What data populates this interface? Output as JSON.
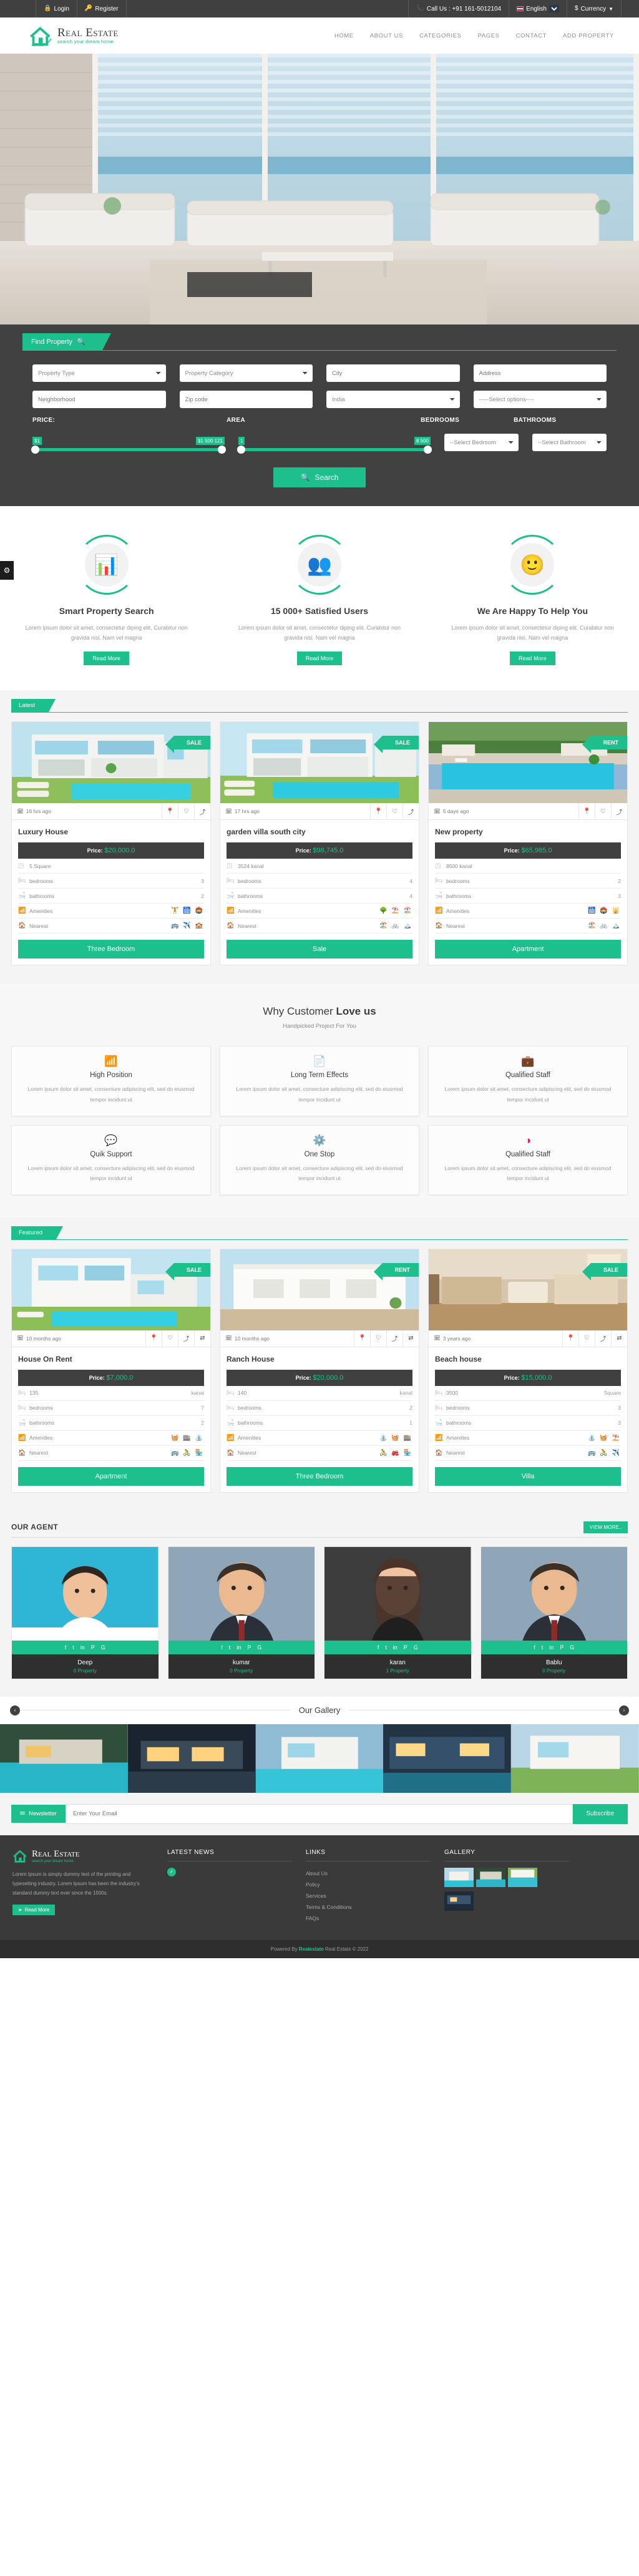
{
  "topbar": {
    "login": "Login",
    "register": "Register",
    "call_us": "Call Us : +91 161-5012104",
    "language": "English",
    "currency": "Currency",
    "lock_icon": "lock-icon",
    "key_icon": "key-icon",
    "phone_icon": "phone-icon",
    "dollar_icon": "dollar-icon"
  },
  "header": {
    "logo_title": "Real Estate",
    "logo_sub": "search your dream home",
    "nav": [
      {
        "label": "HOME"
      },
      {
        "label": "ABOUT US"
      },
      {
        "label": "CATEGORIES"
      },
      {
        "label": "PAGES"
      },
      {
        "label": "CONTACT"
      },
      {
        "label": "ADD PROPERTY"
      }
    ]
  },
  "search": {
    "tab_label": "Find Property",
    "tab_icon": "search-icon",
    "fields_row1": [
      {
        "name": "property-type",
        "type": "select",
        "value": "Property Type"
      },
      {
        "name": "property-category",
        "type": "select",
        "value": "Property Category"
      },
      {
        "name": "city",
        "type": "text",
        "placeholder": "City"
      },
      {
        "name": "address",
        "type": "text",
        "placeholder": "Address"
      }
    ],
    "fields_row2": [
      {
        "name": "neighborhood",
        "type": "text",
        "placeholder": "Neighborhood"
      },
      {
        "name": "zipcode",
        "type": "text",
        "placeholder": "Zip code"
      },
      {
        "name": "country",
        "type": "select",
        "value": "India"
      },
      {
        "name": "options",
        "type": "select",
        "value": "-----Select options----"
      }
    ],
    "labels": {
      "price": "PRICE:",
      "area": "AREA",
      "bedrooms": "BEDROOMS",
      "bathrooms": "BATHROOMS"
    },
    "price_min": "$1",
    "price_max": "$1 500 121",
    "area_min": "1",
    "area_max": "8 500",
    "bedroom_select": "--Select Bedroom",
    "bathroom_select": "--Select Bathroom",
    "search_button": "Search"
  },
  "features": [
    {
      "icon": "chart-search-icon",
      "glyph": "📊",
      "title": "Smart Property Search",
      "text": "Lorem ipsum dolor sit amet, consectetur diping elit. Curabitur non gravida nisi. Nam vel magna",
      "button": "Read More"
    },
    {
      "icon": "users-icon",
      "glyph": "👥",
      "title": "15 000+ Satisfied Users",
      "text": "Lorem ipsum dolor sit amet, consectetur diping elit. Curabitur non gravida nisi. Nam vel magna",
      "button": "Read More"
    },
    {
      "icon": "smiley-icon",
      "glyph": "🙂",
      "title": "We Are Happy To Help You",
      "text": "Lorem ipsum dolor sit amet, consectetur diping elit. Curabitur non gravida nisi. Nam vel magna",
      "button": "Read More"
    }
  ],
  "latest": {
    "ribbon": "Latest",
    "cards": [
      {
        "tag": "SALE",
        "time": "16 hrs ago",
        "title": "Luxury House",
        "price_label": "Price:",
        "price": "$20,000.0",
        "area": "5 Square",
        "bedrooms_label": "bedrooms",
        "bedrooms": "3",
        "bathrooms_label": "bathrooms",
        "bathrooms": "2",
        "amenities_label": "Amenities",
        "amenities": "🏋️ 🛗 🏟️",
        "nearest_label": "Nearest",
        "nearest": "🚌 ✈️ 🏫",
        "button": "Three Bedroom",
        "img_class": "img-villa1"
      },
      {
        "tag": "SALE",
        "time": "17 hrs ago",
        "title": "garden villa south city",
        "price_label": "Price:",
        "price": "$98,745.0",
        "area": "3524 kanal",
        "bedrooms_label": "bedrooms",
        "bedrooms": "4",
        "bathrooms_label": "bathrooms",
        "bathrooms": "4",
        "amenities_label": "Amenities",
        "amenities": "🌳 ⛱️ 🏖️",
        "nearest_label": "Nearest",
        "nearest": "🏖️ 🚲 🏔️",
        "button": "Sale",
        "img_class": "img-villa2"
      },
      {
        "tag": "RENT",
        "time": "5 days ago",
        "title": "New property",
        "price_label": "Price:",
        "price": "$65,985.0",
        "area": "8500 kanal",
        "bedrooms_label": "bedrooms",
        "bedrooms": "2",
        "bathrooms_label": "bathrooms",
        "bathrooms": "3",
        "amenities_label": "Amenities",
        "amenities": "🛗 🏟️ 🕌",
        "nearest_label": "Nearest",
        "nearest": "🏖️ 🚲 🏔️",
        "button": "Apartment",
        "img_class": "img-pool"
      }
    ]
  },
  "why": {
    "title_light": "Why Customer ",
    "title_bold": "Love us",
    "subtitle": "Handpicked Project For You",
    "cards": [
      {
        "icon": "bar-chart-icon",
        "glyph": "📶",
        "color": "#ea1e63",
        "title": "High Position",
        "text": "Lorem ipsum dolor sit amet, consecture adipiscing elit, sed do eiusmod tempor incidunt ut"
      },
      {
        "icon": "document-icon",
        "glyph": "📄",
        "color": "#14c4d4",
        "title": "Long Term Effects",
        "text": "Lorem ipsum dolor sit amet, consecture adipiscing elit, sed do eiusmod tempor incidunt ut"
      },
      {
        "icon": "briefcase-icon",
        "glyph": "💼",
        "color": "#1b8fd4",
        "title": "Qualified Staff",
        "text": "Lorem ipsum dolor sit amet, consecture adipiscing elit, sed do eiusmod tempor incidunt ut"
      },
      {
        "icon": "chat-bubble-icon",
        "glyph": "💬",
        "color": "#fbb713",
        "title": "Quik Support",
        "text": "Lorem ipsum dolor sit amet, consecture adipiscing elit, sed do eiusmod tempor incidunt ut"
      },
      {
        "icon": "gear-icon",
        "glyph": "⚙️",
        "color": "#fbb713",
        "title": "One Stop",
        "text": "Lorem ipsum dolor sit amet, consecture adipiscing elit, sed do eiusmod tempor incidunt ut"
      },
      {
        "icon": "contrast-circle-icon",
        "glyph": "◑",
        "color": "#e8195b",
        "title": "Qualified Staff",
        "text": "Lorem ipsum dolor sit amet, consecture adipiscing elit, sed do eiusmod tempor incidunt ut"
      }
    ]
  },
  "featured": {
    "ribbon": "Featured",
    "cards": [
      {
        "tag": "SALE",
        "time": "10 months ago",
        "title": "House On Rent",
        "price_label": "Price:",
        "price": "$7,000.0",
        "area_value": "135",
        "area_unit": "kanal",
        "bedrooms_label": "bedrooms",
        "bedrooms": "7",
        "bathrooms_label": "bathrooms",
        "bathrooms": "2",
        "amenities_label": "Amenities",
        "amenities": "🧺 🏬 ⛲",
        "nearest_label": "Nearest",
        "nearest": "🚌 🚴 🏪",
        "button": "Apartment",
        "img_class": "img-modern"
      },
      {
        "tag": "RENT",
        "time": "10 months ago",
        "title": "Ranch House",
        "price_label": "Price:",
        "price": "$20,000.0",
        "area_value": "140",
        "area_unit": "kanal",
        "bedrooms_label": "bedrooms",
        "bedrooms": "2",
        "bathrooms_label": "bathrooms",
        "bathrooms": "1",
        "amenities_label": "Amenities",
        "amenities": "⛲ 🧺 🏬",
        "nearest_label": "Nearest",
        "nearest": "🚴 🚒 🏪",
        "button": "Three Bedroom",
        "img_class": "img-white"
      },
      {
        "tag": "SALE",
        "time": "3 years ago",
        "title": "Beach house",
        "price_label": "Price:",
        "price": "$15,000.0",
        "area_value": "3500",
        "area_unit": "Square",
        "bedrooms_label": "bedrooms",
        "bedrooms": "3",
        "bathrooms_label": "bathrooms",
        "bathrooms": "3",
        "amenities_label": "Amenities",
        "amenities": "⛲ 🧺 ⛱️",
        "nearest_label": "Nearest",
        "nearest": "🚌 🚴 ✈️",
        "button": "Villa",
        "img_class": "img-interior"
      }
    ]
  },
  "agents": {
    "title": "OUR AGENT",
    "view_more": "VIEW MORE..",
    "socials": [
      "f",
      "t",
      "in",
      "P",
      "G"
    ],
    "list": [
      {
        "name": "Deep",
        "property": "0 Property",
        "img_class": "ag1"
      },
      {
        "name": "kumar",
        "property": "0 Property",
        "img_class": "ag2"
      },
      {
        "name": "karan",
        "property": "1 Property",
        "img_class": "ag3"
      },
      {
        "name": "Bablu",
        "property": "0 Property",
        "img_class": "ag4"
      }
    ]
  },
  "gallery": {
    "title": "Our Gallery",
    "prev_icon": "chevron-left-icon",
    "next_icon": "chevron-right-icon",
    "items": [
      {
        "img_class": "g1"
      },
      {
        "img_class": "g2"
      },
      {
        "img_class": "g3"
      },
      {
        "img_class": "g4"
      },
      {
        "img_class": "g5"
      }
    ]
  },
  "newsletter": {
    "tag": "Newsletter",
    "tag_icon": "envelope-icon",
    "placeholder": "Enter Your Email",
    "button": "Subscribe"
  },
  "footer": {
    "logo_title": "Real Estate",
    "logo_sub": "search your dream home",
    "about_text": "Lorem Ipsum is simply dummy text of the printing and typesetting industry. Lorem Ipsum has been the industry's standard dummy text ever since the 1500s.",
    "read_more": "Read More",
    "latest_news_title": "LATEST NEWS",
    "links_title": "LINKS",
    "gallery_title": "GALLERY",
    "links": [
      {
        "label": "About Us"
      },
      {
        "label": "Policy"
      },
      {
        "label": "Services"
      },
      {
        "label": "Terms & Conditions"
      },
      {
        "label": "FAQs"
      }
    ],
    "gallery_items": [
      {
        "img_class": "fg1"
      },
      {
        "img_class": "fg2"
      },
      {
        "img_class": "fg3"
      },
      {
        "img_class": "fg4"
      }
    ],
    "copyright_pre": "Powered By ",
    "copyright_brand": "Realestate",
    "copyright_post": " Real Estate © 2022"
  },
  "colors": {
    "accent": "#1dc08c",
    "dark": "#404040",
    "topbar": "#404040"
  }
}
